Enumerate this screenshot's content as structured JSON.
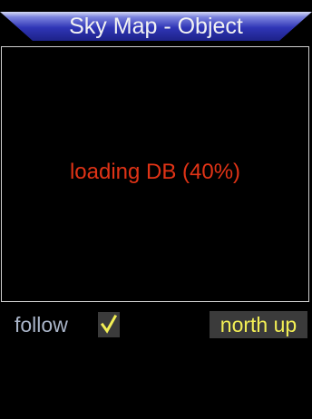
{
  "header": {
    "title": "Sky Map - Object",
    "accent_color": "#2f35b6"
  },
  "map": {
    "status_text": "loading DB (40%)",
    "loading_progress_percent": 40,
    "status_color": "#e03316"
  },
  "controls": {
    "follow_label": "follow",
    "follow_checked": true,
    "follow_icon": "checkmark-icon",
    "north_up_label": "north up"
  }
}
